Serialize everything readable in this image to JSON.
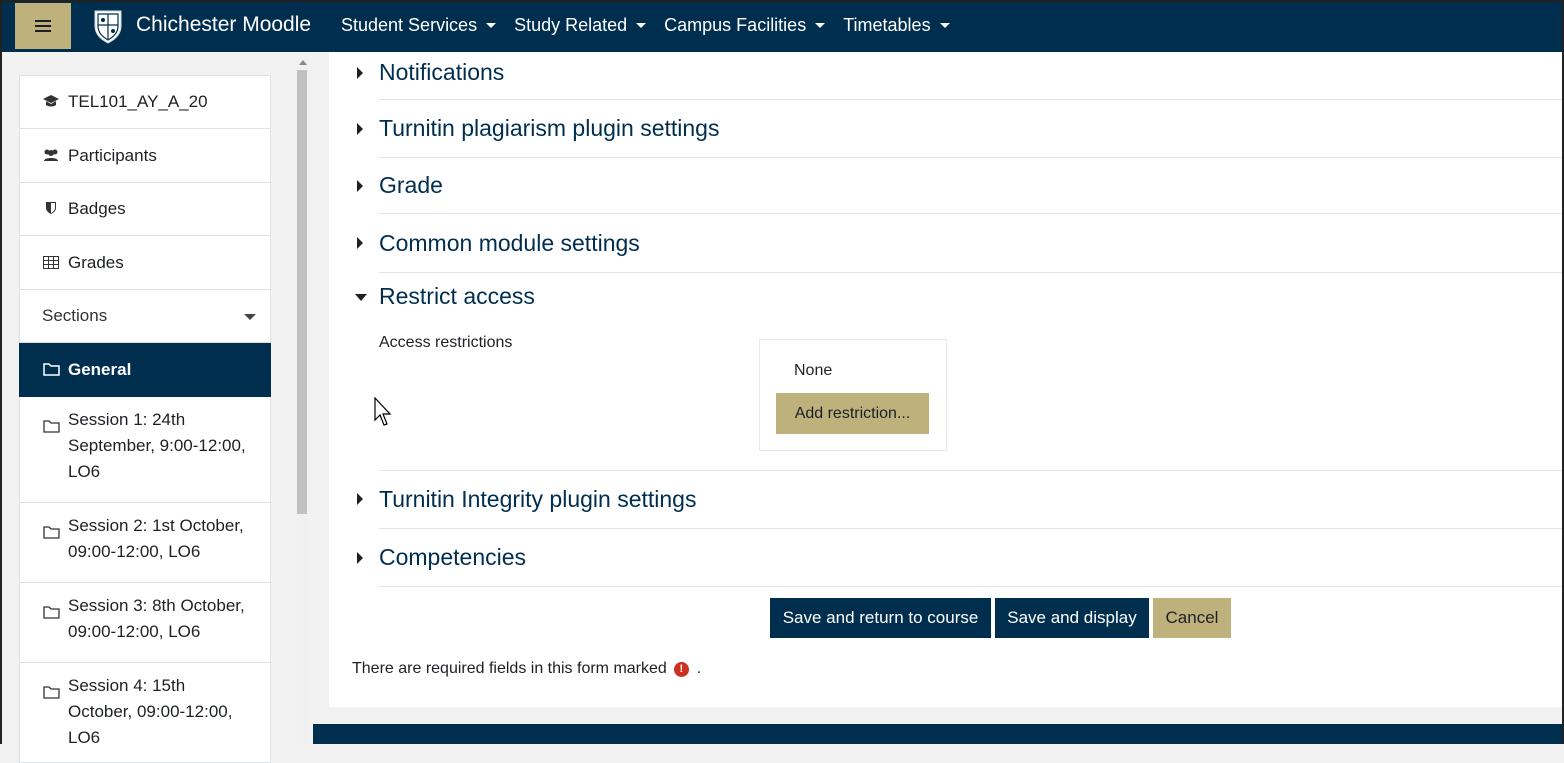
{
  "navbar": {
    "brand": "Chichester Moodle",
    "items": [
      "Student Services",
      "Study Related",
      "Campus Facilities",
      "Timetables"
    ]
  },
  "sidebar": {
    "items": [
      {
        "icon": "graduation-cap-icon",
        "label": "TEL101_AY_A_20"
      },
      {
        "icon": "users-icon",
        "label": "Participants"
      },
      {
        "icon": "shield-icon",
        "label": "Badges"
      },
      {
        "icon": "table-icon",
        "label": "Grades"
      },
      {
        "icon": "",
        "label": "Sections"
      },
      {
        "icon": "folder-icon",
        "label": "General"
      },
      {
        "icon": "folder-icon",
        "label": "Session 1: 24th September, 9:00-12:00, LO6"
      },
      {
        "icon": "folder-icon",
        "label": "Session 2: 1st October, 09:00-12:00, LO6"
      },
      {
        "icon": "folder-icon",
        "label": "Session 3: 8th October, 09:00-12:00, LO6"
      },
      {
        "icon": "folder-icon",
        "label": "Session 4: 15th October, 09:00-12:00, LO6"
      }
    ]
  },
  "sections": {
    "notifications": "Notifications",
    "turnitin_plagiarism": "Turnitin plagiarism plugin settings",
    "grade": "Grade",
    "common_module": "Common module settings",
    "restrict_access": "Restrict access",
    "turnitin_integrity": "Turnitin Integrity plugin settings",
    "competencies": "Competencies"
  },
  "restrict": {
    "label": "Access restrictions",
    "none": "None",
    "add_button": "Add restriction..."
  },
  "buttons": {
    "save_return": "Save and return to course",
    "save_display": "Save and display",
    "cancel": "Cancel"
  },
  "required_note": {
    "text": "There are required fields in this form marked",
    "icon": "!",
    "suffix": "."
  },
  "colors": {
    "primary": "#002e4f",
    "accent": "#beb17c",
    "required": "#ca3120"
  }
}
